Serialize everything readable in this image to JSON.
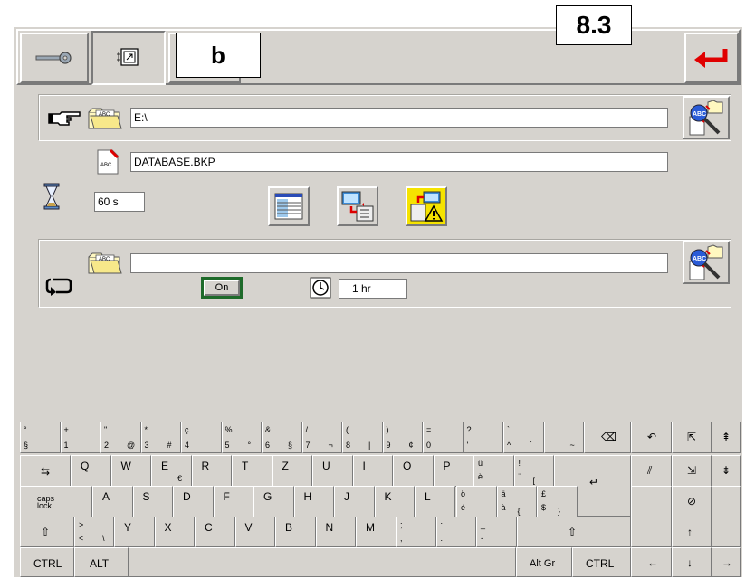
{
  "overlay": {
    "page_number": "8.3",
    "tab_letter": "b"
  },
  "toolbar": {
    "key_icon": "key-icon",
    "tab_icon": "window-select-icon",
    "enter_icon": "enter-arrow-icon",
    "enter_color": "#e00000"
  },
  "backup": {
    "path_value": "E:\\",
    "file_value": "DATABASE.BKP",
    "timeout_value": "60 s"
  },
  "schedule": {
    "path_value": "",
    "toggle_label": "On",
    "interval_value": "1 hr"
  },
  "keyboard": {
    "row1": [
      {
        "top": "°",
        "bot": "§"
      },
      {
        "top": "+",
        "bot": "1"
      },
      {
        "top": "\"",
        "bot": "2",
        "alt": "@"
      },
      {
        "top": "*",
        "bot": "3",
        "alt": "#"
      },
      {
        "top": "ç",
        "bot": "4"
      },
      {
        "top": "%",
        "bot": "5",
        "alt": "°"
      },
      {
        "top": "&",
        "bot": "6",
        "alt": "§"
      },
      {
        "top": "/",
        "bot": "7",
        "alt": "¬"
      },
      {
        "top": "(",
        "bot": "8",
        "alt": "|"
      },
      {
        "top": ")",
        "bot": "9",
        "alt": "¢"
      },
      {
        "top": "=",
        "bot": "0"
      },
      {
        "top": "?",
        "bot": "'"
      },
      {
        "top": "`",
        "bot": "^",
        "alt": "´"
      },
      {
        "top": "",
        "bot": "",
        "alt": "~"
      }
    ],
    "row2": [
      "Q",
      "W",
      "E",
      "R",
      "T",
      "Z",
      "U",
      "I",
      "O",
      "P"
    ],
    "row3": [
      "A",
      "S",
      "D",
      "F",
      "G",
      "H",
      "J",
      "K",
      "L"
    ],
    "row4": [
      "Y",
      "X",
      "C",
      "V",
      "B",
      "N",
      "M"
    ],
    "caps_label": "caps lock",
    "ctrl_label": "CTRL",
    "alt_label": "ALT",
    "altgr_label": "Alt Gr",
    "row2_extra": [
      {
        "top": "ü",
        "bot": "è"
      },
      {
        "top": "!",
        "bot": "¨",
        "alt": "["
      }
    ],
    "row3_extra": [
      {
        "top": "ö",
        "bot": "é"
      },
      {
        "top": "ä",
        "bot": "à",
        "alt": "{"
      },
      {
        "top": "£",
        "bot": "$",
        "alt": "}"
      }
    ],
    "row4_extra": [
      {
        "top": ">",
        "bot": "<",
        "alt": "\\"
      },
      {
        "top": ";",
        "bot": ","
      },
      {
        "top": ":",
        "bot": "."
      },
      {
        "top": "_",
        "bot": "-"
      }
    ],
    "e_alt": "€"
  }
}
